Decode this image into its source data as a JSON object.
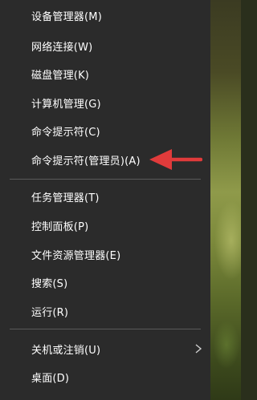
{
  "menu": {
    "items": [
      {
        "label": "设备管理器(M)"
      },
      {
        "label": "网络连接(W)"
      },
      {
        "label": "磁盘管理(K)"
      },
      {
        "label": "计算机管理(G)"
      },
      {
        "label": "命令提示符(C)"
      },
      {
        "label": "命令提示符(管理员)(A)"
      },
      {
        "label": "任务管理器(T)"
      },
      {
        "label": "控制面板(P)"
      },
      {
        "label": "文件资源管理器(E)"
      },
      {
        "label": "搜索(S)"
      },
      {
        "label": "运行(R)"
      },
      {
        "label": "关机或注销(U)"
      },
      {
        "label": "桌面(D)"
      }
    ]
  },
  "colors": {
    "menu_background": "#2b2b2b",
    "text": "#ffffff",
    "separator": "#5a5a5a",
    "annotation_arrow": "#e03b3b"
  },
  "icons": {
    "submenu": "chevron-right-icon",
    "annotation": "red-arrow-icon"
  }
}
